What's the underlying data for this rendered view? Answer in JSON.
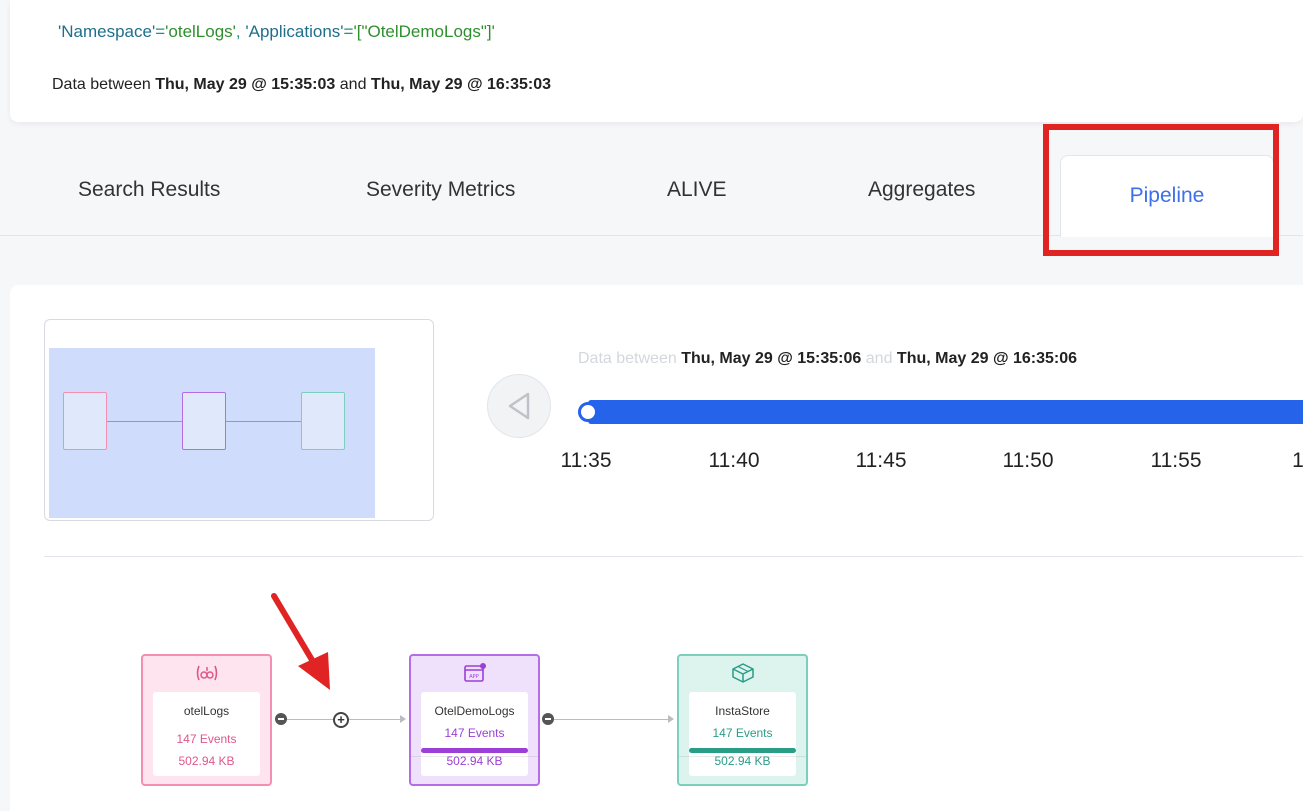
{
  "query": {
    "ns_key": "'Namespace'",
    "ns_eq": "=",
    "ns_val": "'otelLogs'",
    "sep": ", ",
    "app_key": "'Applications'",
    "app_eq": "=",
    "app_val": "'[\"OtelDemoLogs\"]'"
  },
  "range": {
    "prefix": "Data between",
    "start": "Thu, May 29 @ 15:35:03",
    "and": "and",
    "end": "Thu, May 29 @ 16:35:03"
  },
  "tabs": [
    {
      "label": "Search Results"
    },
    {
      "label": "Severity Metrics"
    },
    {
      "label": "ALIVE"
    },
    {
      "label": "Aggregates"
    },
    {
      "label": "Pipeline"
    }
  ],
  "active_tab": "Pipeline",
  "timeline": {
    "prefix": "Data between",
    "start": "Thu, May 29 @ 15:35:06",
    "and": "and",
    "end": "Thu, May 29 @ 16:35:06",
    "ticks": [
      "11:35",
      "11:40",
      "11:45",
      "11:50",
      "11:55",
      "1"
    ]
  },
  "nodes": [
    {
      "name": "otelLogs",
      "events": "147 Events",
      "size": "502.94 KB",
      "icon": "namespace-icon",
      "color": "#f48fb1",
      "bg": "#fde4ee",
      "text": "#e0568a"
    },
    {
      "name": "OtelDemoLogs",
      "events": "147 Events",
      "size": "502.94 KB",
      "icon": "app-icon",
      "color": "#b36ee6",
      "bg": "#efe1fb",
      "text": "#9b3fd6"
    },
    {
      "name": "InstaStore",
      "events": "147 Events",
      "size": "502.94 KB",
      "icon": "store-icon",
      "color": "#7ccfbd",
      "bg": "#ddf3ee",
      "text": "#2a9d86"
    }
  ],
  "colors": {
    "accent": "#2563eb",
    "active_tab": "#3d6fe8",
    "highlight": "#e02424"
  }
}
